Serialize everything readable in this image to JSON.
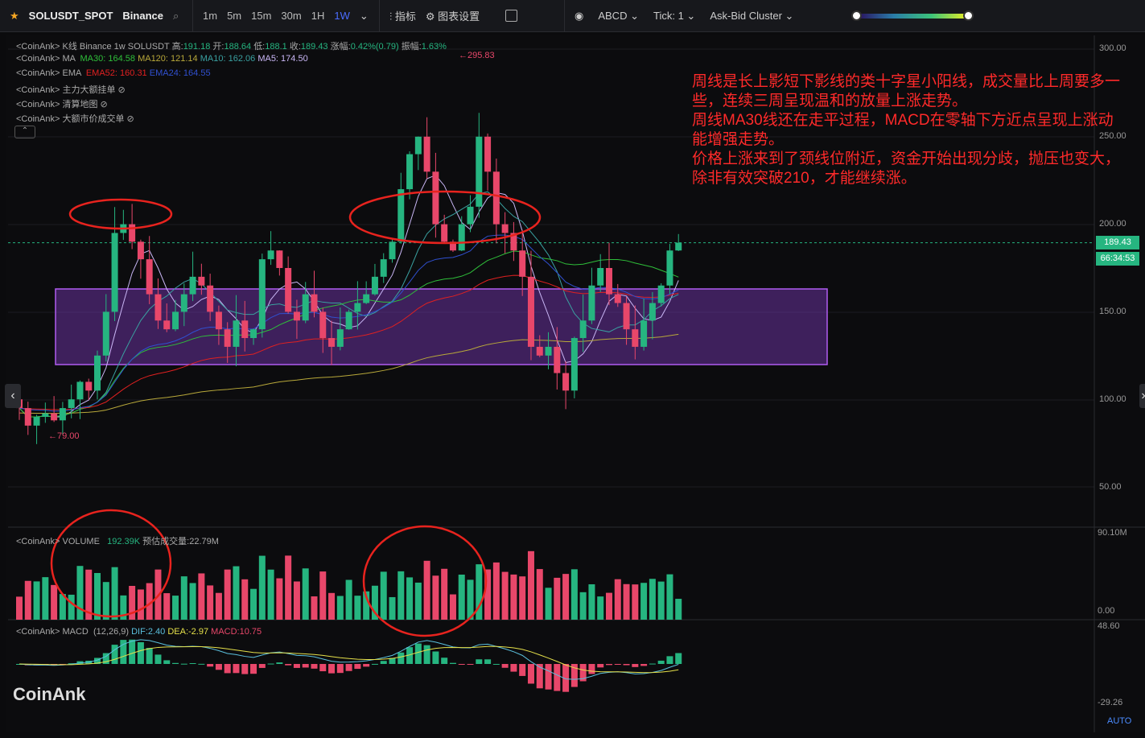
{
  "toolbar": {
    "symbol": "SOLUSDT_SPOT",
    "exchange": "Binance",
    "timeframes": [
      "1m",
      "5m",
      "15m",
      "30m",
      "1H",
      "1W"
    ],
    "active_tf": "1W",
    "indicators": "指标",
    "chart_settings": "图表设置",
    "drawing": "ABCD",
    "tick_label": "Tick:",
    "tick_value": "1",
    "cluster": "Ask-Bid Cluster"
  },
  "legend": {
    "kline": {
      "prefix": "<CoinAnk> K线  Binance 1w SOLUSDT",
      "high_l": "高:",
      "high": "191.18",
      "open_l": "开:",
      "open": "188.64",
      "low_l": "低:",
      "low": "188.1",
      "close_l": "收:",
      "close": "189.43",
      "chg_l": "涨幅:",
      "chg": "0.42%(0.79)",
      "amp_l": "振幅:",
      "amp": "1.63%"
    },
    "ma": {
      "prefix": "<CoinAnk> MA",
      "ma30": "MA30: 164.58",
      "ma120": "MA120: 121.14",
      "ma10": "MA10: 162.06",
      "ma5": "MA5: 174.50"
    },
    "ema": {
      "prefix": "<CoinAnk> EMA",
      "ema52": "EMA52: 160.31",
      "ema24": "EMA24: 164.55"
    },
    "l4": "<CoinAnk> 主力大额挂单",
    "l5": "<CoinAnk> 清算地图",
    "l6": "<CoinAnk> 大额市价成交单",
    "volume": {
      "prefix": "<CoinAnk> VOLUME",
      "value": "192.39K",
      "est": "预估成交量:22.79M"
    },
    "macd": {
      "prefix": "<CoinAnk> MACD",
      "params": "(12,26,9)",
      "dif": "DIF:2.40",
      "dea": "DEA:-2.97",
      "macd": "MACD:10.75"
    }
  },
  "annotation": [
    "周线是长上影短下影线的类十字星小阳线，成交量比上周要多一些，连续三周呈现温和的放量上涨走势。",
    "周线MA30线还在走平过程，MACD在零轴下方近点呈现上涨动能增强走势。",
    "价格上涨来到了颈线位附近，资金开始出现分歧，抛压也变大，除非有效突破210，才能继续涨。"
  ],
  "price_axis": [
    "300.00",
    "250.00",
    "200.00",
    "150.00",
    "100.00",
    "50.00"
  ],
  "price_tag": "189.43",
  "countdown": "66:34:53",
  "high_mark": "←295.83",
  "low_mark": "←79.00",
  "vol_axis": [
    "90.10M",
    "0.00"
  ],
  "macd_axis": [
    "48.60",
    "-29.26"
  ],
  "auto": "AUTO",
  "brand": "CoinAnk",
  "colors": {
    "up": "#26b580",
    "down": "#e8476a",
    "zone": "#8a3fd1",
    "circle": "#e8231e"
  },
  "chart_data": {
    "type": "candlestick",
    "closes": [
      95,
      85,
      90,
      92,
      88,
      95,
      100,
      110,
      105,
      125,
      150,
      195,
      200,
      190,
      180,
      160,
      145,
      140,
      150,
      160,
      170,
      165,
      150,
      140,
      130,
      145,
      135,
      140,
      180,
      185,
      175,
      150,
      145,
      160,
      150,
      135,
      130,
      140,
      150,
      155,
      160,
      170,
      180,
      190,
      220,
      240,
      250,
      230,
      200,
      190,
      185,
      200,
      210,
      250,
      230,
      200,
      195,
      185,
      170,
      130,
      125,
      130,
      115,
      105,
      135,
      145,
      165,
      175,
      160,
      155,
      140,
      130,
      145,
      155,
      165,
      185,
      189.43
    ],
    "ylim": [
      30,
      305
    ]
  }
}
